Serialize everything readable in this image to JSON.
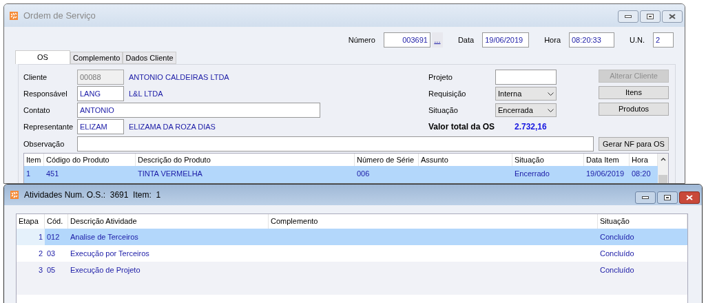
{
  "main_window": {
    "title": "Ordem de Serviço",
    "header": [
      {
        "label": "Número",
        "value": "003691",
        "lookup": "..."
      },
      {
        "label": "Data",
        "value": "19/06/2019"
      },
      {
        "label": "Hora",
        "value": "08:20:33"
      },
      {
        "label": "U.N.",
        "value": "2"
      }
    ],
    "tabs": [
      {
        "label": "OS",
        "selected": true
      },
      {
        "label": "Complemento",
        "selected": false
      },
      {
        "label": "Dados Cliente",
        "selected": false
      }
    ],
    "left_fields": [
      {
        "kind": "code",
        "label": "Cliente",
        "value": "00088",
        "disabled": true,
        "description": "ANTONIO CALDEIRAS LTDA"
      },
      {
        "kind": "code",
        "label": "Responsável",
        "value": "LANG",
        "disabled": false,
        "description": "L&L LTDA"
      },
      {
        "kind": "text",
        "label": "Contato",
        "value": "ANTONIO"
      },
      {
        "kind": "code",
        "label": "Representante",
        "value": "ELIZAM",
        "disabled": false,
        "description": "ELIZAMA DA ROZA DIAS"
      }
    ],
    "right_fields": [
      {
        "kind": "text",
        "label": "Projeto"
      },
      {
        "kind": "select",
        "label": "Requisição",
        "value": "Interna"
      },
      {
        "kind": "select",
        "label": "Situação",
        "value": "Encerrada"
      }
    ],
    "total": {
      "label": "Valor total da OS",
      "value": "2.732,16"
    },
    "buttons": [
      {
        "label": "Alterar Cliente",
        "disabled": true
      },
      {
        "label": "Itens",
        "disabled": false
      },
      {
        "label": "Produtos",
        "disabled": false
      }
    ],
    "observation": {
      "label": "Observação"
    },
    "nf_button": "Gerar NF para OS",
    "items_table": {
      "columns": [
        "Item",
        "Código do Produto",
        "Descrição do Produto",
        "Número de Série",
        "Assunto",
        "Situação",
        "Data Item",
        "Hora"
      ],
      "rows": [
        {
          "selected": true,
          "cells": [
            "1",
            "451",
            "TINTA VERMELHA",
            "006",
            "",
            "Encerrado",
            "19/06/2019",
            "08:20"
          ]
        }
      ]
    }
  },
  "activities_window": {
    "title": "Atividades Num. O.S.:  3691  Item:  1",
    "table": {
      "columns": [
        "Etapa",
        "Cód.",
        "Descrição Atividade",
        "Complemento",
        "Situação"
      ],
      "rows": [
        {
          "selected": true,
          "cells": [
            "1",
            "012",
            "Analise de Terceiros",
            "",
            "Concluído"
          ]
        },
        {
          "selected": false,
          "cells": [
            "2",
            "03",
            "Execução por Terceiros",
            "",
            "Concluído"
          ]
        },
        {
          "selected": false,
          "cells": [
            "3",
            "05",
            "Execução de Projeto",
            "",
            "Concluído"
          ]
        }
      ]
    }
  }
}
